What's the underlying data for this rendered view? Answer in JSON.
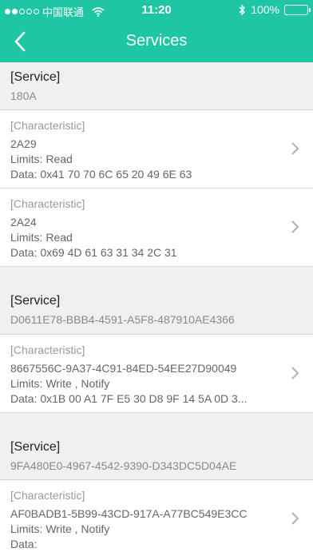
{
  "status_bar": {
    "carrier": "中国联通",
    "time": "11:20",
    "battery": "100%"
  },
  "nav": {
    "title": "Services",
    "back_icon": "chevron-left-icon"
  },
  "colors": {
    "header": "#1ec6a4",
    "background": "#f0f0f2"
  },
  "services": [
    {
      "label": "[Service]",
      "uuid": "180A",
      "characteristics": [
        {
          "label": "[Characteristic]",
          "uuid": "2A29",
          "limits": "Limits: Read",
          "data": "Data: 0x41 70 70 6C 65 20 49 6E 63"
        },
        {
          "label": "[Characteristic]",
          "uuid": "2A24",
          "limits": "Limits: Read",
          "data": "Data: 0x69 4D 61 63 31 34 2C 31"
        }
      ]
    },
    {
      "label": "[Service]",
      "uuid": "D0611E78-BBB4-4591-A5F8-487910AE4366",
      "characteristics": [
        {
          "label": "[Characteristic]",
          "uuid": "8667556C-9A37-4C91-84ED-54EE27D90049",
          "limits": "Limits: Write , Notify",
          "data": "Data: 0x1B 00 A1 7F E5 30 D8 9F 14 5A 0D 3..."
        }
      ]
    },
    {
      "label": "[Service]",
      "uuid": "9FA480E0-4967-4542-9390-D343DC5D04AE",
      "characteristics": [
        {
          "label": "[Characteristic]",
          "uuid": "AF0BADB1-5B99-43CD-917A-A77BC549E3CC",
          "limits": "Limits: Write , Notify",
          "data": "Data:"
        }
      ]
    }
  ]
}
